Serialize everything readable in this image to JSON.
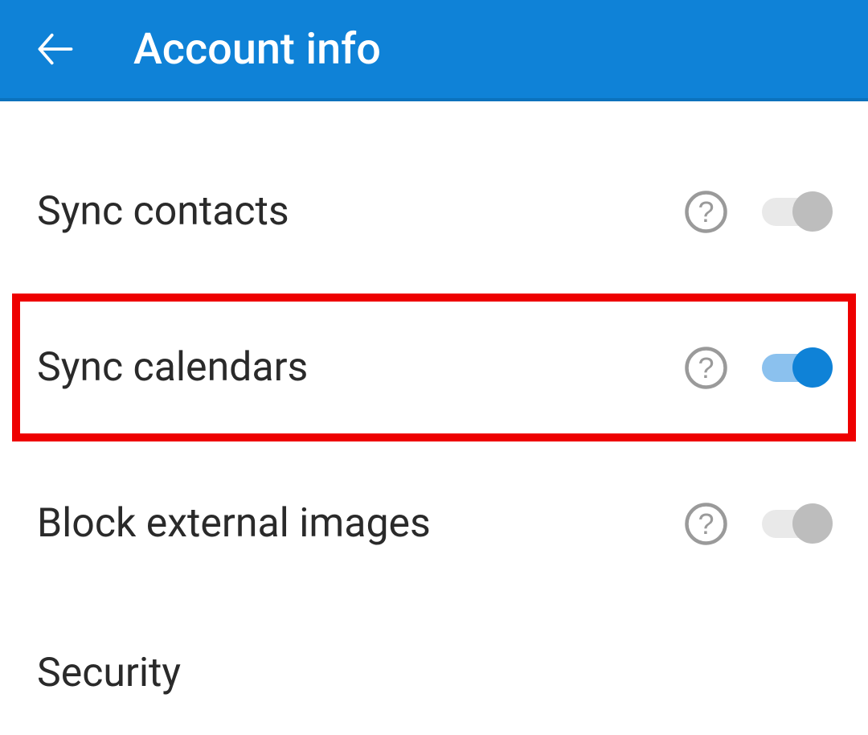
{
  "header": {
    "title": "Account info"
  },
  "settings": {
    "sync_contacts": {
      "label": "Sync contacts",
      "enabled": false
    },
    "sync_calendars": {
      "label": "Sync calendars",
      "enabled": true,
      "highlighted": true
    },
    "block_external_images": {
      "label": "Block external images",
      "enabled": false
    }
  },
  "sections": {
    "security": {
      "label": "Security"
    }
  }
}
